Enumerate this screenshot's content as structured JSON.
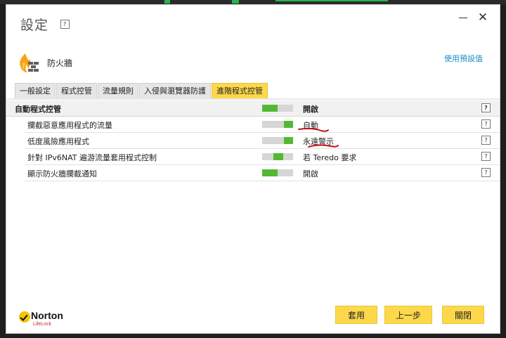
{
  "window": {
    "title": "設定",
    "help_glyph": "?",
    "minimize_icon": "minimize-icon",
    "close_glyph": "✕"
  },
  "header": {
    "icon": "firewall-icon",
    "label": "防火牆",
    "link": "使用預設值"
  },
  "tabs": [
    {
      "label": "一般設定",
      "active": false
    },
    {
      "label": "程式控管",
      "active": false
    },
    {
      "label": "流量規則",
      "active": false
    },
    {
      "label": "入侵與瀏覽器防護",
      "active": false
    },
    {
      "label": "進階程式控管",
      "active": true
    }
  ],
  "section": {
    "label": "自動程式控管",
    "value": "開啟",
    "toggle_state": "on"
  },
  "rows": [
    {
      "label": "攔截惡意應用程式的流量",
      "value": "自動",
      "toggle_state": "auto"
    },
    {
      "label": "低度風險應用程式",
      "value": "永遠警示",
      "toggle_state": "always"
    },
    {
      "label": "針對 IPv6NAT 遍游流量套用程式控制",
      "value": "若 Teredo 要求",
      "toggle_state": "conditional"
    },
    {
      "label": "顯示防火牆攔截通知",
      "value": "開啟",
      "toggle_state": "on"
    }
  ],
  "footer": {
    "logo": {
      "name": "Norton",
      "sub": "LifeLock"
    },
    "buttons": {
      "apply": "套用",
      "back": "上一步",
      "close": "關閉"
    }
  },
  "colors": {
    "accent": "#fdd84b",
    "toggle_on": "#54b836",
    "link": "#1a8fc5",
    "annotation": "#c0151b"
  }
}
